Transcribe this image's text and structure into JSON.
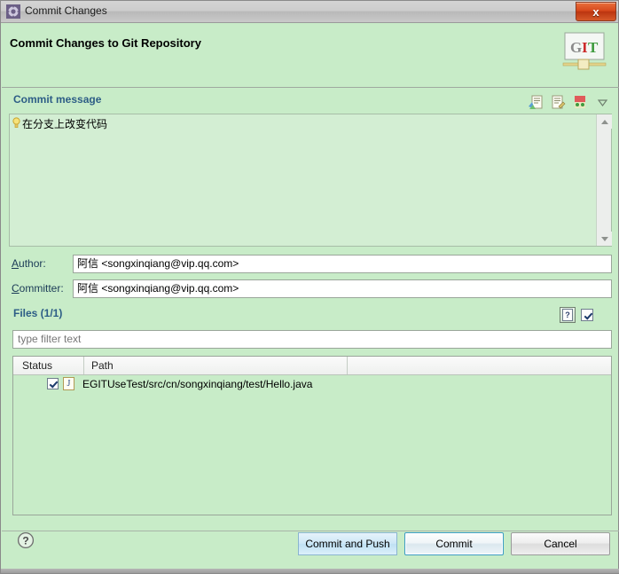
{
  "window": {
    "title": "Commit Changes",
    "title_icon": "gear-icon",
    "close_label": "x"
  },
  "header": {
    "heading": "Commit Changes to Git Repository",
    "logo_text": "GIT",
    "logo_letters": [
      "G",
      "I",
      "T"
    ]
  },
  "commit_message": {
    "group_label": "Commit message",
    "text": "在分支上改变代码",
    "toolbar": [
      {
        "name": "spell-check-icon",
        "title": "Spell check"
      },
      {
        "name": "signed-off-icon",
        "title": "Add signed-off-by"
      },
      {
        "name": "change-id-icon",
        "title": "Add Change-Id"
      },
      {
        "name": "chevron-down-icon",
        "title": "More options"
      }
    ],
    "hint_icon": "lightbulb-icon"
  },
  "author": {
    "label": "Author:",
    "mnemonic": "A",
    "label_rest": "uthor:",
    "value": "阿信 <songxinqiang@vip.qq.com>"
  },
  "committer": {
    "label": "Committer:",
    "mnemonic": "C",
    "label_rest": "ommitter:",
    "value": "阿信 <songxinqiang@vip.qq.com>"
  },
  "files": {
    "group_label": "Files (1/1)",
    "toolbar": [
      {
        "name": "show-untracked-toggle",
        "glyph": "?",
        "pressed": true
      },
      {
        "name": "select-all-checkbox",
        "glyph": "check"
      },
      {
        "name": "deselect-all-checkbox",
        "glyph": "blank"
      }
    ],
    "filter_placeholder": "type filter text",
    "filter_value": "",
    "columns": [
      "Status",
      "Path"
    ],
    "rows": [
      {
        "checked": true,
        "file_icon": "java-file-icon",
        "file_icon_glyph": "J",
        "status": "",
        "path": "EGITUseTest/src/cn/songxinqiang/test/Hello.java"
      }
    ]
  },
  "footer": {
    "help_icon": "help-icon",
    "buttons": [
      {
        "name": "commit-and-push-button",
        "label": "Commit and Push"
      },
      {
        "name": "commit-button",
        "label": "Commit"
      },
      {
        "name": "cancel-button",
        "label": "Cancel"
      }
    ]
  },
  "colors": {
    "dialog_bg": "#c8ecc8",
    "group_label": "#2d5d86",
    "field_label": "#1a3a56",
    "close_button": "#d8491c"
  }
}
